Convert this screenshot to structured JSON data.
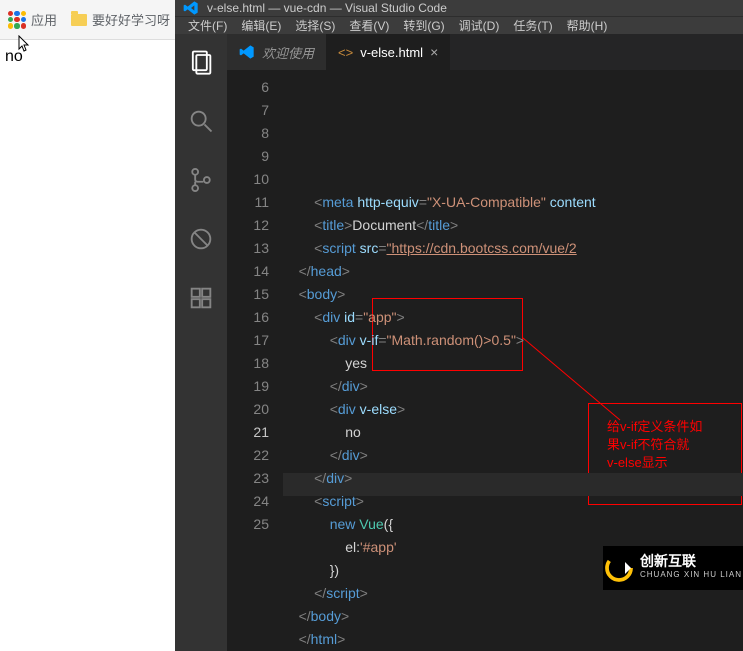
{
  "chrome": {
    "apps_label": "应用",
    "bookmark1": "要好好学习呀"
  },
  "page": {
    "body_text": "no"
  },
  "vscode": {
    "title": "v-else.html — vue-cdn — Visual Studio Code",
    "menu": [
      "文件(F)",
      "编辑(E)",
      "选择(S)",
      "查看(V)",
      "转到(G)",
      "调试(D)",
      "任务(T)",
      "帮助(H)"
    ],
    "tabs": {
      "welcome": "欢迎使用",
      "active": "v-else.html"
    },
    "gutter_start": 6,
    "gutter_end": 25,
    "current_line": 21,
    "code": {
      "l6": {
        "indent": "        ",
        "pre": "<",
        "tag": "meta",
        "mid": " ",
        "attr": "http-equiv",
        "eq": "=",
        "str": "\"X-UA-Compatible\"",
        "mid2": " ",
        "attr2": "content"
      },
      "l7": {
        "indent": "        ",
        "pre": "<",
        "tag": "title",
        "gt": ">",
        "txt": "Document",
        "pre2": "</",
        "tag2": "title",
        "gt2": ">"
      },
      "l8": {
        "indent": "        ",
        "pre": "<",
        "tag": "script",
        "sp": " ",
        "attr": "src",
        "eq": "=",
        "str": "\"https://cdn.bootcss.com/vue/2"
      },
      "l9": {
        "indent": "    ",
        "pre": "</",
        "tag": "head",
        "gt": ">"
      },
      "l10": {
        "indent": "    ",
        "pre": "<",
        "tag": "body",
        "gt": ">"
      },
      "l11": {
        "indent": "        ",
        "pre": "<",
        "tag": "div",
        "sp": " ",
        "attr": "id",
        "eq": "=",
        "str": "\"app\"",
        "gt": ">"
      },
      "l12": {
        "indent": "            ",
        "pre": "<",
        "tag": "div",
        "sp": " ",
        "attr": "v-if",
        "eq": "=",
        "str": "\"Math.random()>0.5\"",
        "gt": ">"
      },
      "l13": {
        "indent": "                ",
        "txt": "yes"
      },
      "l14": {
        "indent": "            ",
        "pre": "</",
        "tag": "div",
        "gt": ">"
      },
      "l15": {
        "indent": "            ",
        "pre": "<",
        "tag": "div",
        "sp": " ",
        "attr": "v-else",
        "gt": ">"
      },
      "l16": {
        "indent": "                ",
        "txt": "no"
      },
      "l17": {
        "indent": "            ",
        "pre": "</",
        "tag": "div",
        "gt": ">"
      },
      "l18": {
        "indent": "        ",
        "pre": "</",
        "tag": "div",
        "gt": ">"
      },
      "l19": {
        "indent": "        ",
        "pre": "<",
        "tag": "script",
        "gt": ">"
      },
      "l20": {
        "indent": "            ",
        "kw": "new",
        "sp": " ",
        "cls": "Vue",
        "txt": "({"
      },
      "l21": {
        "indent": "                ",
        "txt": "el:",
        "str": "'#app'"
      },
      "l22": {
        "indent": "            ",
        "txt": "})"
      },
      "l23": {
        "indent": "        ",
        "pre": "</",
        "tag": "script",
        "gt": ">"
      },
      "l24": {
        "indent": "    ",
        "pre": "</",
        "tag": "body",
        "gt": ">"
      },
      "l25": {
        "indent": "    ",
        "pre": "</",
        "tag": "html",
        "gt": ">"
      }
    }
  },
  "annotation": {
    "text_line1": "给v-if定义条件如",
    "text_line2": "果v-if不符合就",
    "text_line3": "v-else显示"
  },
  "watermark": {
    "main": "创新互联",
    "sub": "CHUANG XIN HU LIAN"
  }
}
